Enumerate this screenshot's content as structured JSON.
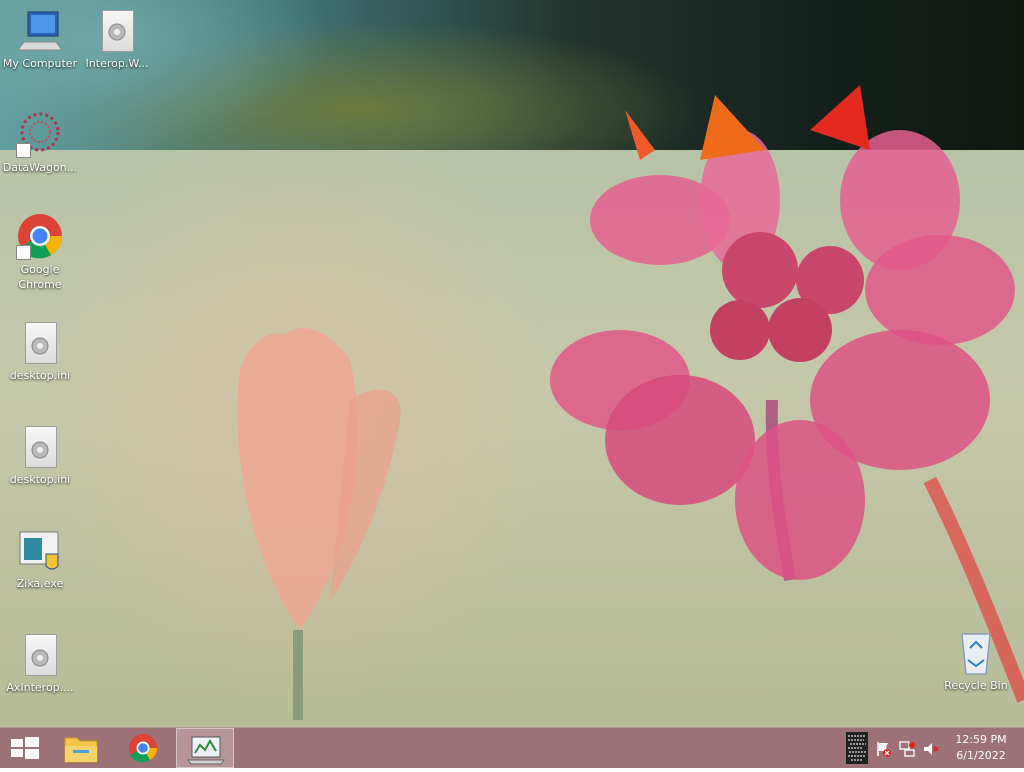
{
  "desktop": {
    "icons": [
      {
        "label": "My Computer"
      },
      {
        "label": "Interop.W..."
      },
      {
        "label": "DataWagon..."
      },
      {
        "label": "Google Chrome"
      },
      {
        "label": "desktop.ini"
      },
      {
        "label": "desktop.ini"
      },
      {
        "label": "Zika.exe"
      },
      {
        "label": "AxInterop...."
      },
      {
        "label": "Recycle Bin"
      }
    ]
  },
  "taskbar": {
    "clock_time": "12:59 PM",
    "clock_date": "6/1/2022"
  },
  "colors": {
    "taskbar": "#966070",
    "chrome_red": "#db4437",
    "chrome_green": "#0f9d58",
    "chrome_yellow": "#f4b400",
    "chrome_blue": "#4285f4"
  }
}
